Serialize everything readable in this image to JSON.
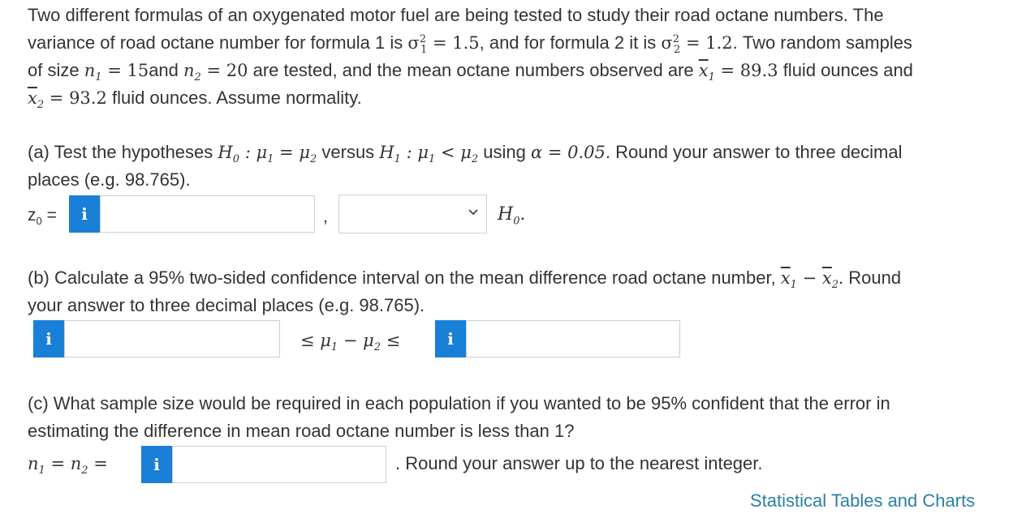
{
  "intro": {
    "t1": "Two different formulas of an oxygenated motor fuel are being tested to study their road octane numbers. The",
    "t2": "variance of road octane number for formula 1 is ",
    "s1": "σ",
    "s1_sup": "2",
    "s1_sub": "1",
    "eq_val1": " = 1.5",
    "t3": ", and for formula 2 it is ",
    "s2": "σ",
    "s2_sup": "2",
    "s2_sub": "2",
    "eq_val2": " = 1.2",
    "t4": ". Two random samples",
    "t5": "of size ",
    "n1": "n",
    "n1_sub": "1",
    "n1_val": " = 15",
    "t6": "and ",
    "n2": "n",
    "n2_sub": "2",
    "n2_val": " = 20",
    "t7": " are tested, and the mean octane numbers observed are ",
    "x1": "x",
    "x1_sub": "1",
    "x1_val": " = 89.3",
    "t8": " fluid ounces and",
    "x2": "x",
    "x2_sub": "2",
    "x2_val": " = 93.2",
    "t9": " fluid ounces. Assume normality."
  },
  "part_a": {
    "t1": "(a) Test the hypotheses ",
    "h0": "H",
    "h0_sub": "0",
    "h0_expr1": " : μ",
    "h0_mu1_sub": "1",
    "h0_eq": " = μ",
    "h0_mu2_sub": "2",
    "t2": " versus ",
    "h1": "H",
    "h1_sub": "1",
    "h1_expr1": " : μ",
    "h1_mu1_sub": "1",
    "h1_lt": " < μ",
    "h1_mu2_sub": "2",
    "t3": " using ",
    "alpha": "α = 0.05",
    "t4": ". Round your answer to three decimal",
    "t5": "places (e.g. 98.765).",
    "z_label": "z",
    "z_sub": "0",
    "z_eq": " =",
    "comma": ",",
    "h0_suffix_main": "H",
    "h0_suffix_sub": "0",
    "h0_suffix_dot": ".",
    "z_value": "",
    "decision_value": ""
  },
  "part_b": {
    "t1": "(b) Calculate a 95% two-sided confidence interval on the mean difference road octane number, ",
    "x1": "x",
    "x1_sub": "1",
    "minus": " − ",
    "x2": "x",
    "x2_sub": "2",
    "t2": ". Round",
    "t3": "your answer to three decimal places (e.g. 98.765).",
    "ineq_le1": "≤ μ",
    "ineq_sub1": "1",
    "ineq_minus": " − μ",
    "ineq_sub2": "2",
    "ineq_le2": " ≤",
    "lower_value": "",
    "upper_value": ""
  },
  "part_c": {
    "t1": "(c) What sample size would be required in each population if you wanted to be 95% confident that the error in",
    "t2": "estimating the difference in mean road octane number is less than 1?",
    "n_label": "n",
    "n_sub1": "1",
    "n_eq": " = n",
    "n_sub2": "2",
    "n_eq2": " =",
    "round_text": ". Round your answer up to the nearest integer.",
    "n_value": ""
  },
  "info_icon": "i",
  "link": "Statistical Tables and Charts",
  "colors": {
    "info_blue": "#1a7fd6",
    "link": "#2a7fa8",
    "text": "#333333",
    "border": "#cfcfcf"
  }
}
